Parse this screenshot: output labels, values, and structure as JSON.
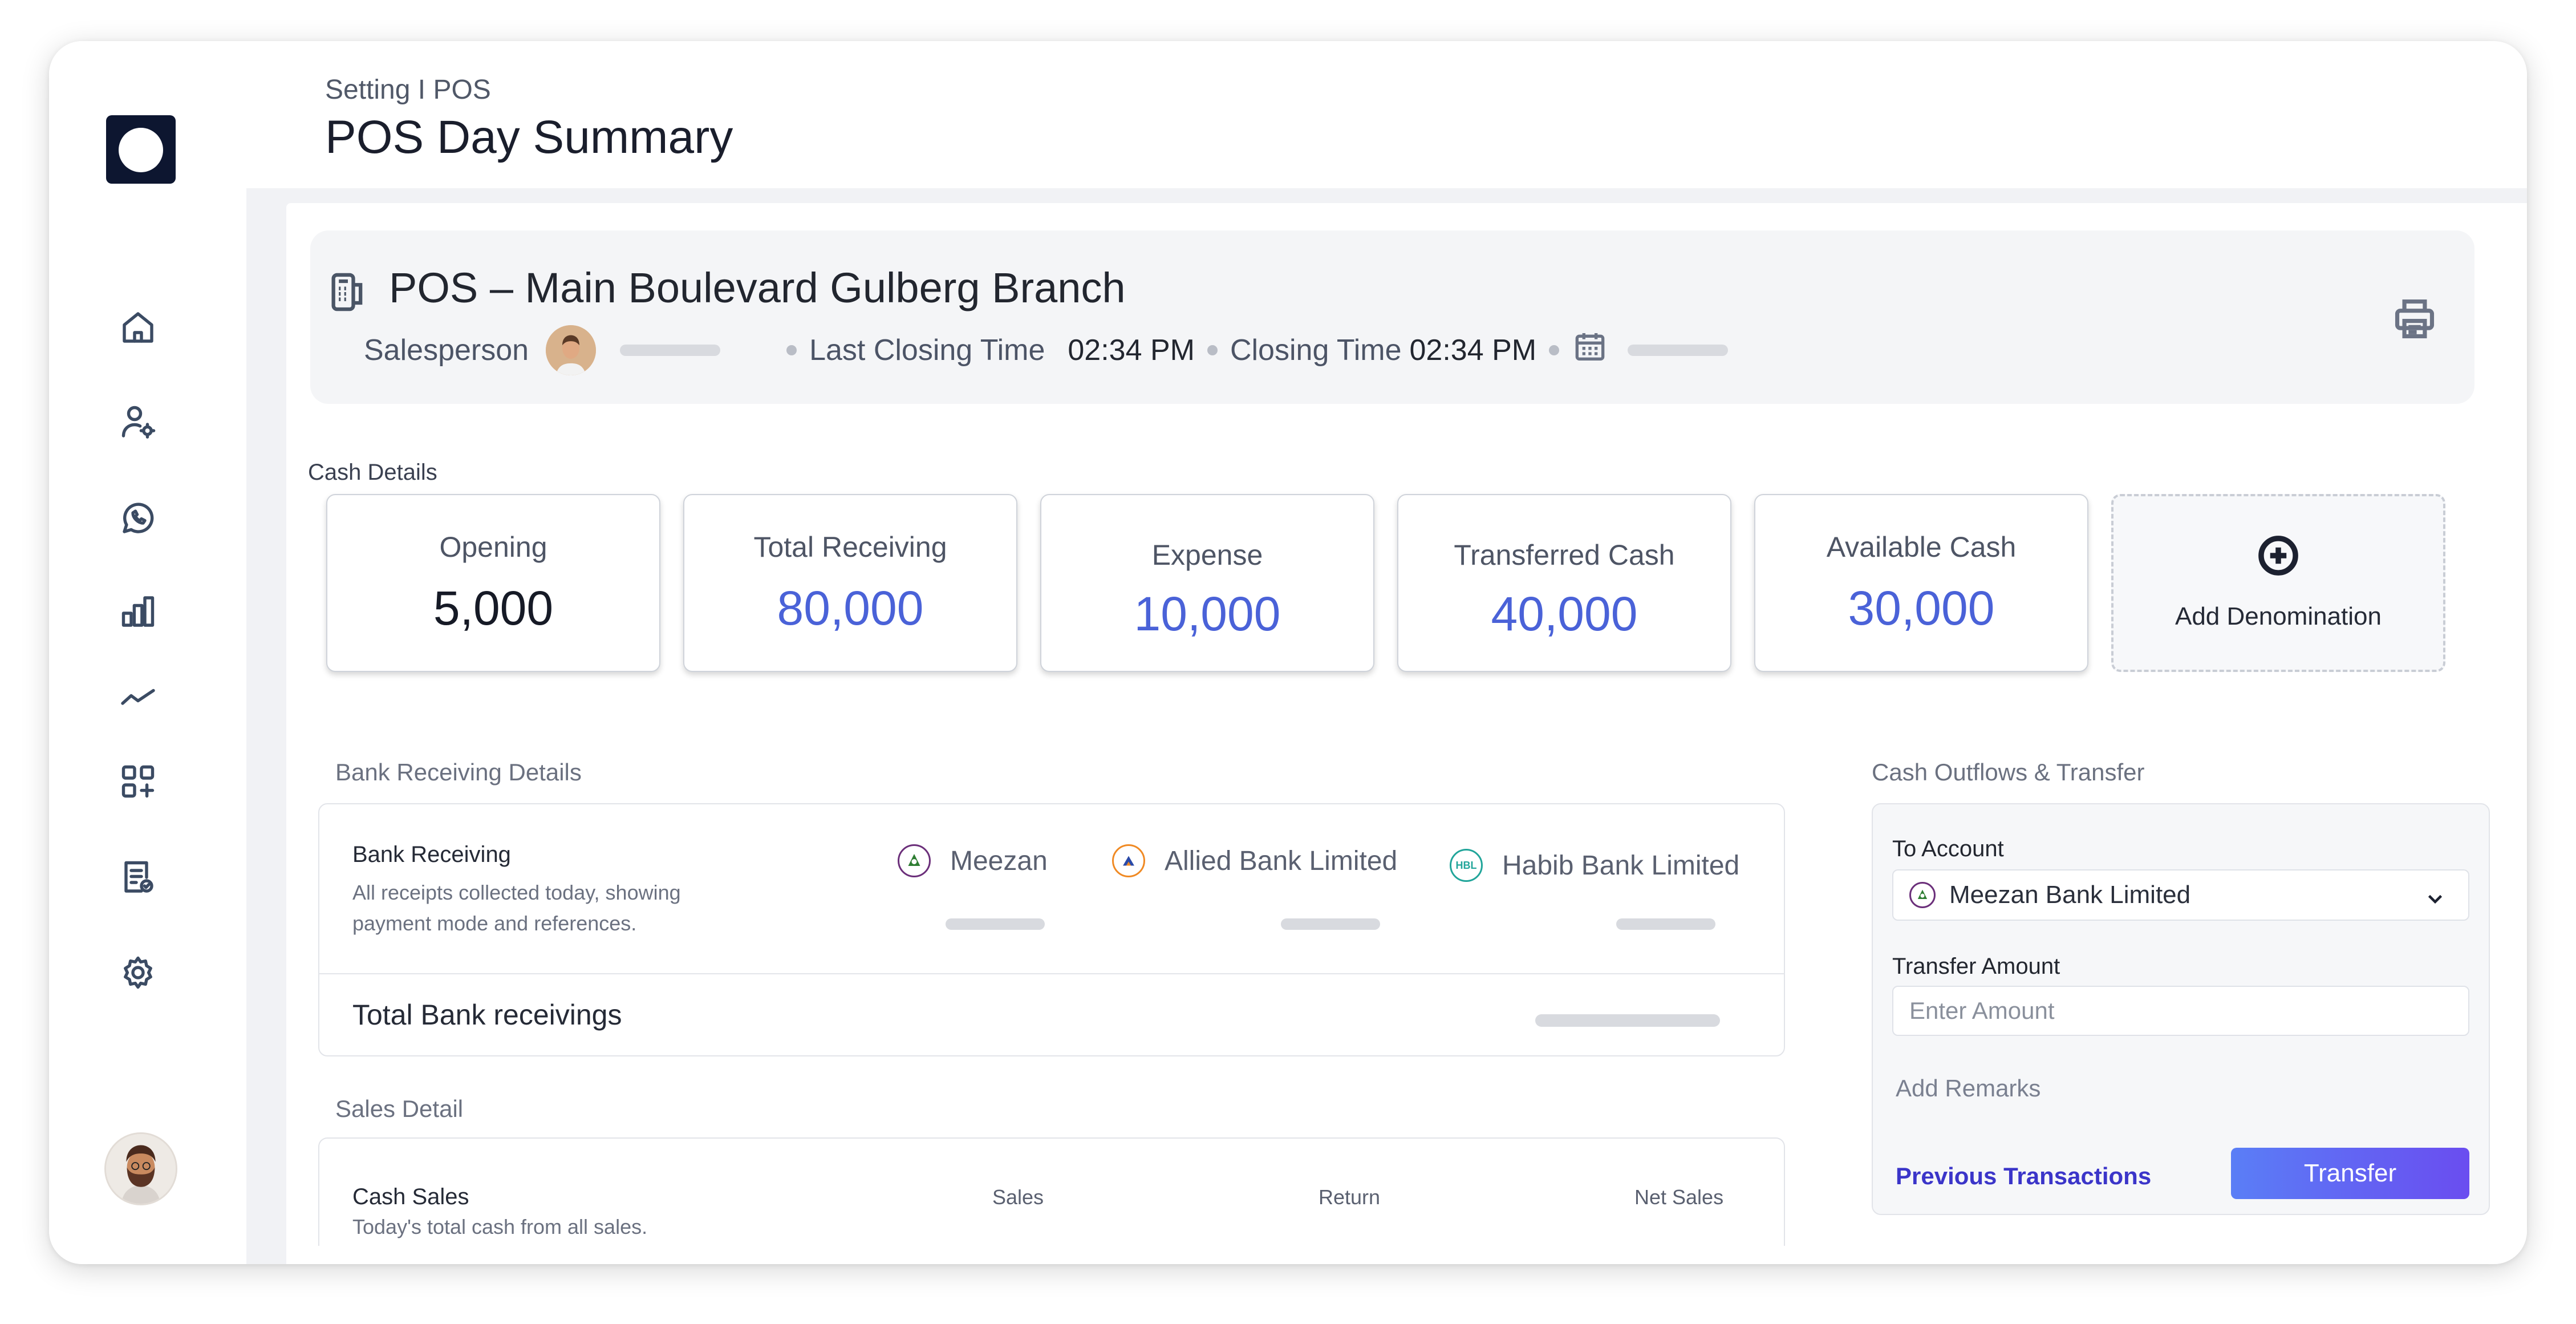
{
  "header": {
    "breadcrumb": "Setting I POS",
    "title": "POS Day Summary"
  },
  "sidebar": {
    "items": [
      {
        "name": "home-icon"
      },
      {
        "name": "user-settings-icon"
      },
      {
        "name": "whatsapp-icon"
      },
      {
        "name": "bar-chart-icon"
      },
      {
        "name": "trend-line-icon"
      },
      {
        "name": "add-widget-icon"
      },
      {
        "name": "report-icon"
      },
      {
        "name": "gear-icon"
      }
    ]
  },
  "pos": {
    "title": "POS – Main Boulevard Gulberg Branch",
    "salesperson_label": "Salesperson",
    "last_closing_label": "Last Closing Time",
    "last_closing_time": "02:34 PM",
    "closing_label": "Closing Time",
    "closing_time": "02:34 PM"
  },
  "cash_details": {
    "label": "Cash Details",
    "cards": [
      {
        "label": "Opening",
        "value": "5,000"
      },
      {
        "label": "Total Receiving",
        "value": "80,000"
      },
      {
        "label": "Expense",
        "value": "10,000"
      },
      {
        "label": "Transferred Cash",
        "value": "40,000"
      },
      {
        "label": "Available Cash",
        "value": "30,000"
      }
    ],
    "add_denomination": "Add Denomination"
  },
  "bank_receiving": {
    "section_label": "Bank Receiving Details",
    "title": "Bank Receiving",
    "description": "All receipts collected today, showing payment mode and references.",
    "banks": [
      "Meezan",
      "Allied Bank Limited",
      "Habib Bank Limited"
    ],
    "total_label": "Total Bank receivings"
  },
  "sales_detail": {
    "section_label": "Sales Detail",
    "title": "Cash Sales",
    "description": "Today's total cash from all sales.",
    "columns": [
      "Sales",
      "Return",
      "Net Sales"
    ]
  },
  "transfer": {
    "section_label": "Cash Outflows & Transfer",
    "to_account_label": "To Account",
    "to_account_value": "Meezan Bank Limited",
    "amount_label": "Transfer Amount",
    "amount_placeholder": "Enter Amount",
    "remarks": "Add Remarks",
    "previous_link": "Previous Transactions",
    "button": "Transfer"
  },
  "colors": {
    "accent": "#4a62d8",
    "link": "#3b35c9",
    "sidebar_logo": "#0d1630"
  }
}
